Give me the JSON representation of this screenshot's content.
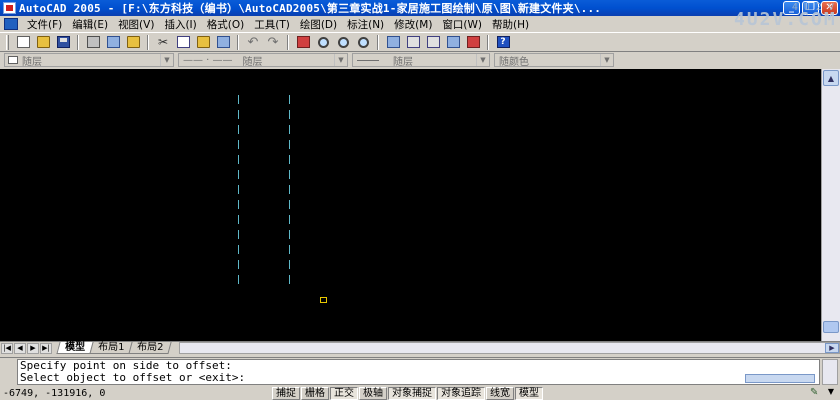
{
  "window": {
    "title": "AutoCAD 2005 - [F:\\东方科技（编书）\\AutoCAD2005\\第三章实战1-家居施工图绘制\\原\\图\\新建文件夹\\...",
    "min_label": "_",
    "max_label": "❐",
    "close_label": "✕"
  },
  "watermark": {
    "top": "4 U 2 V",
    "big": "4U2V.COM"
  },
  "menu": {
    "items": [
      {
        "label": "文件(F)"
      },
      {
        "label": "编辑(E)"
      },
      {
        "label": "视图(V)"
      },
      {
        "label": "插入(I)"
      },
      {
        "label": "格式(O)"
      },
      {
        "label": "工具(T)"
      },
      {
        "label": "绘图(D)"
      },
      {
        "label": "标注(N)"
      },
      {
        "label": "修改(M)"
      },
      {
        "label": "窗口(W)"
      },
      {
        "label": "帮助(H)"
      }
    ]
  },
  "toolbar": {
    "icons": [
      "new-icon",
      "open-icon",
      "save-icon",
      "print-icon",
      "plot-preview-icon",
      "publish-icon",
      "cut-icon",
      "copy-icon",
      "paste-icon",
      "match-properties-icon",
      "undo-icon",
      "redo-icon",
      "pan-icon",
      "zoom-realtime-icon",
      "zoom-window-icon",
      "zoom-previous-icon",
      "properties-icon",
      "design-center-icon",
      "tool-palettes-icon",
      "dbconnect-icon",
      "markup-icon",
      "help-icon"
    ],
    "cut_glyph": "✂",
    "undo_glyph": "↶",
    "redo_glyph": "↷",
    "help_glyph": "?"
  },
  "properties": {
    "layer": "随层",
    "linetype_prefix": "—— · ——",
    "linetype": "随层",
    "lineweight": "随层",
    "plot_style": "随颜色"
  },
  "drawing": {
    "background": "#000000",
    "line_color": "#5fb8c8",
    "cursor_color": "#e8c800"
  },
  "tabs": {
    "nav": [
      "|◀",
      "◀",
      "▶",
      "▶|"
    ],
    "items": [
      "模型",
      "布局1",
      "布局2"
    ]
  },
  "command": {
    "lines": [
      "Specify point on side to offset:",
      "Select object to offset or <exit>:"
    ]
  },
  "status": {
    "coords": "-6749,  -131916, 0",
    "buttons": [
      {
        "label": "捕捉",
        "on": false
      },
      {
        "label": "栅格",
        "on": false
      },
      {
        "label": "正交",
        "on": true
      },
      {
        "label": "极轴",
        "on": false
      },
      {
        "label": "对象捕捉",
        "on": true
      },
      {
        "label": "对象追踪",
        "on": true
      },
      {
        "label": "线宽",
        "on": false
      },
      {
        "label": "模型",
        "on": true
      }
    ]
  }
}
